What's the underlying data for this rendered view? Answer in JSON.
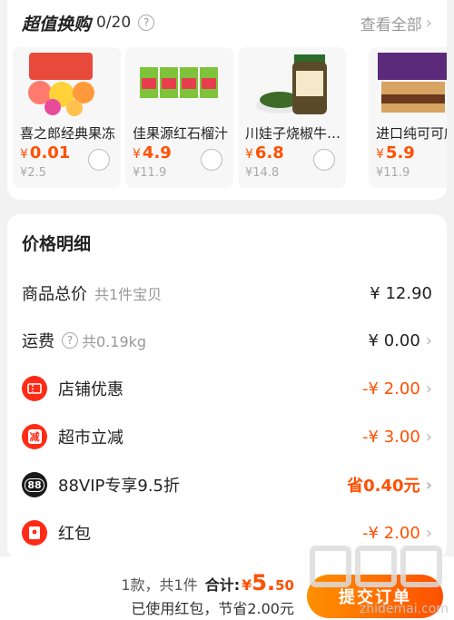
{
  "exchange": {
    "title": "超值换购",
    "count": "0/20",
    "view_all": "查看全部",
    "products": [
      {
        "name": "喜之郎经典果冻",
        "price": "0.01",
        "original": "¥2.5"
      },
      {
        "name": "佳果源红石榴汁",
        "price": "4.9",
        "original": "¥11.9"
      },
      {
        "name": "川娃子烧椒牛肉酱",
        "price": "6.8",
        "original": "¥14.8"
      },
      {
        "name": "进口纯可可威化",
        "price": "5.9",
        "original": "¥11.9"
      }
    ],
    "currency": "¥"
  },
  "detail": {
    "title": "价格明细",
    "rows": [
      {
        "label": "商品总价",
        "sub": "共1件宝贝",
        "value": "¥ 12.90"
      },
      {
        "label": "运费",
        "sub": "共0.19kg",
        "value": "¥ 0.00"
      },
      {
        "label": "店铺优惠",
        "value": "-¥ 2.00"
      },
      {
        "label": "超市立减",
        "value": "-¥ 3.00"
      },
      {
        "label": "88VIP专享9.5折",
        "value": "省0.40元"
      },
      {
        "label": "红包",
        "value": "-¥ 2.00"
      }
    ],
    "icon_reduce_text": "减",
    "icon_vip_text": "88"
  },
  "footer": {
    "count_text": "1款，共1件",
    "total_label": "合计:",
    "currency": "¥",
    "total_int": "5.",
    "total_dec": "50",
    "savings": "已使用红包，节省2.00元",
    "submit": "提交订单"
  },
  "watermark": {
    "site": "zhidemai.com"
  },
  "colors": {
    "accent": "#ff5000",
    "icon_red": "#ff2b16",
    "bg": "#f2f2f2"
  }
}
